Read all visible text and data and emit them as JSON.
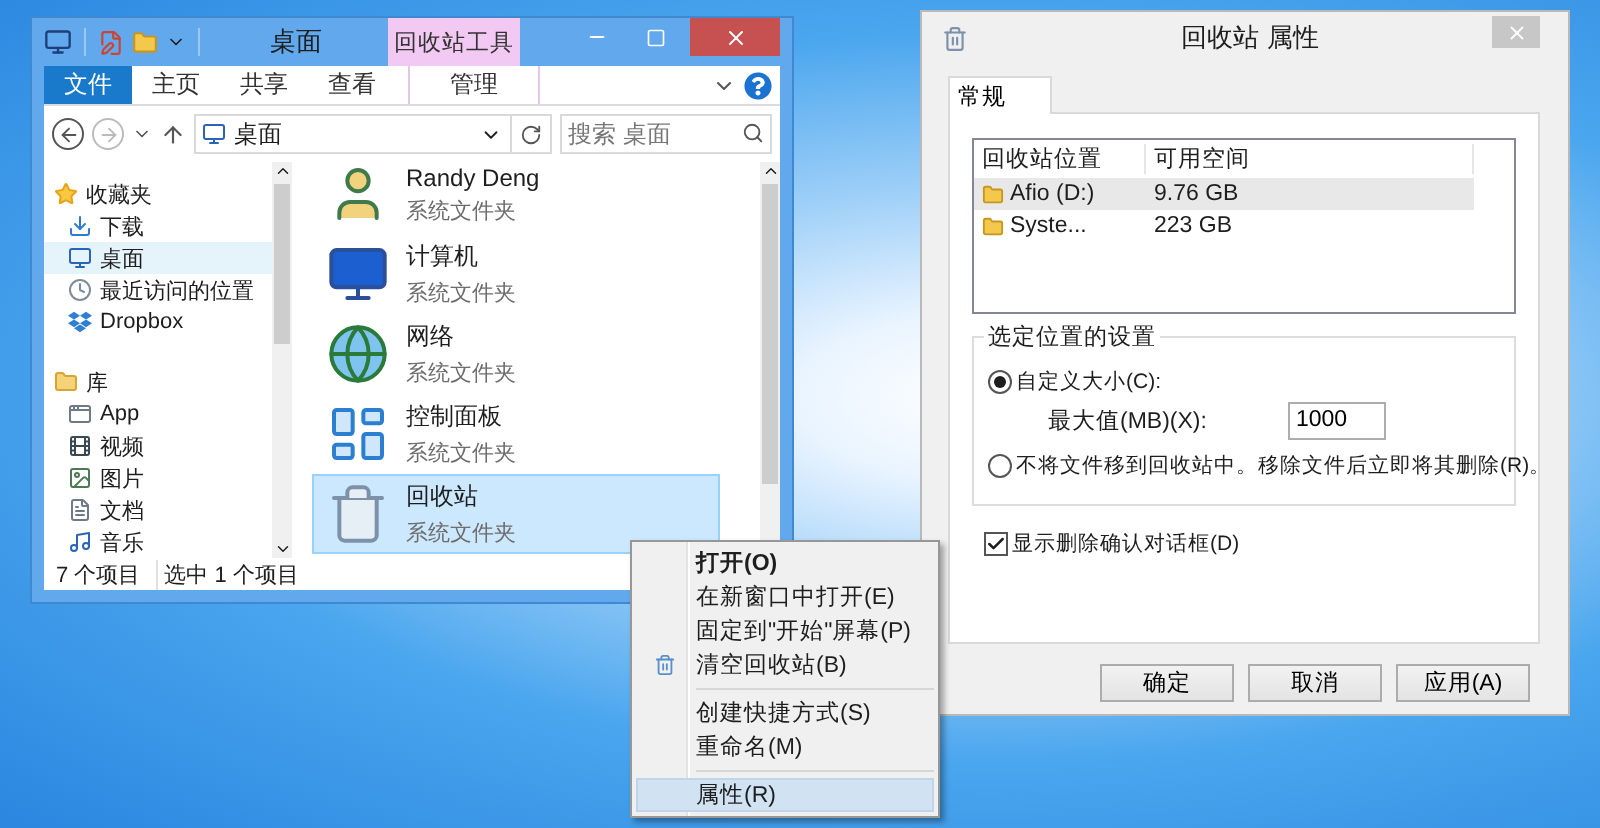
{
  "explorer": {
    "title": "桌面",
    "tool_tab": "回收站工具",
    "ribbon_tabs": [
      {
        "label": "文件",
        "kind": "file"
      },
      {
        "label": "主页",
        "kind": "tab"
      },
      {
        "label": "共享",
        "kind": "tab"
      },
      {
        "label": "查看",
        "kind": "tab"
      },
      {
        "label": "管理",
        "kind": "contextual"
      }
    ],
    "address": "桌面",
    "search": {
      "placeholder": "搜索 桌面"
    },
    "nav": [
      {
        "label": "收藏夹",
        "kind": "favorites",
        "selected": false,
        "children": [
          {
            "label": "下载",
            "kind": "downloads",
            "selected": false
          },
          {
            "label": "桌面",
            "kind": "desktop",
            "selected": true
          },
          {
            "label": "最近访问的位置",
            "kind": "recent",
            "selected": false
          },
          {
            "label": "Dropbox",
            "kind": "dropbox",
            "selected": false
          }
        ]
      },
      {
        "label": "库",
        "kind": "library",
        "selected": false,
        "children": [
          {
            "label": "App",
            "kind": "app",
            "selected": false
          },
          {
            "label": "视频",
            "kind": "video",
            "selected": false
          },
          {
            "label": "图片",
            "kind": "pictures",
            "selected": false
          },
          {
            "label": "文档",
            "kind": "documents",
            "selected": false
          },
          {
            "label": "音乐",
            "kind": "music",
            "selected": false
          }
        ]
      }
    ],
    "items": [
      {
        "name": "Randy Deng",
        "type": "系统文件夹",
        "kind": "user",
        "selected": false
      },
      {
        "name": "计算机",
        "type": "系统文件夹",
        "kind": "computer",
        "selected": false
      },
      {
        "name": "网络",
        "type": "系统文件夹",
        "kind": "network",
        "selected": false
      },
      {
        "name": "控制面板",
        "type": "系统文件夹",
        "kind": "control",
        "selected": false
      },
      {
        "name": "回收站",
        "type": "系统文件夹",
        "kind": "bin",
        "selected": true
      }
    ],
    "status": [
      "7 个项目",
      "选中 1 个项目"
    ]
  },
  "context_menu": {
    "groups": [
      [
        {
          "label": "打开(O)",
          "bold": true,
          "kind": "plain",
          "selected": false
        },
        {
          "label": "在新窗口中打开(E)",
          "bold": false,
          "kind": "plain",
          "selected": false
        },
        {
          "label": "固定到\"开始\"屏幕(P)",
          "bold": false,
          "kind": "plain",
          "selected": false
        },
        {
          "label": "清空回收站(B)",
          "bold": false,
          "kind": "bin",
          "selected": false
        }
      ],
      [
        {
          "label": "创建快捷方式(S)",
          "bold": false,
          "kind": "plain",
          "selected": false
        },
        {
          "label": "重命名(M)",
          "bold": false,
          "kind": "plain",
          "selected": false
        }
      ],
      [
        {
          "label": "属性(R)",
          "bold": false,
          "kind": "plain",
          "selected": true
        }
      ]
    ]
  },
  "properties": {
    "title": "回收站 属性",
    "tab": "常规",
    "columns": [
      "回收站位置",
      "可用空间"
    ],
    "rows": [
      {
        "location": "Afio (D:)",
        "space": "9.76 GB",
        "selected": true
      },
      {
        "location": "Syste...",
        "space": "223 GB",
        "selected": false
      }
    ],
    "group_title": "选定位置的设置",
    "custom": {
      "label": "自定义大小(C):",
      "selected": true,
      "field_label": "最大值(MB)(X):",
      "value": "1000"
    },
    "no_bin": {
      "label": "不将文件移到回收站中。移除文件后立即将其删除(R)。",
      "selected": false
    },
    "confirm": {
      "label": "显示删除确认对话框(D)",
      "checked": true
    },
    "buttons": [
      "确定",
      "取消",
      "应用(A)"
    ]
  }
}
